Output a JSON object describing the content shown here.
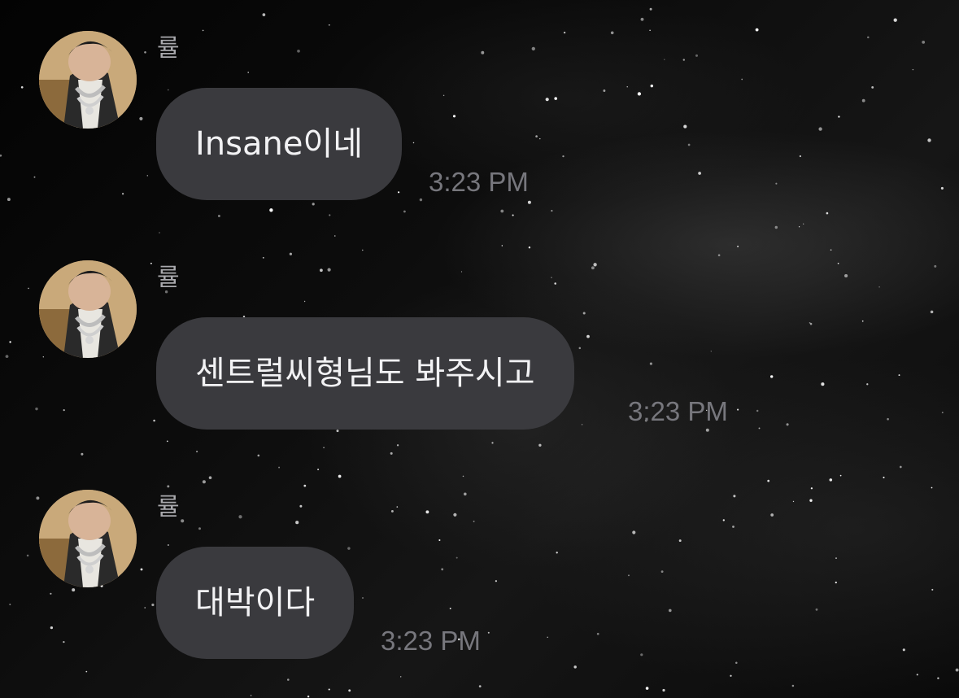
{
  "chat": {
    "messages": [
      {
        "sender": "률",
        "text": "Insane이네",
        "time": "3:23 PM"
      },
      {
        "sender": "률",
        "text": "센트럴씨형님도 봐주시고",
        "time": "3:23 PM"
      },
      {
        "sender": "률",
        "text": "대박이다",
        "time": "3:23 PM"
      }
    ]
  },
  "colors": {
    "bubble": "#3a3a3e",
    "bubble_text": "#f2f2f4",
    "sender_name": "#a9a9ad",
    "timestamp": "#77777d"
  },
  "icons": {
    "avatar": "avatar-photo"
  }
}
